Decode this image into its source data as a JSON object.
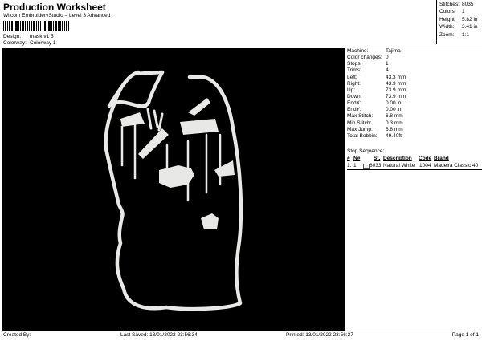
{
  "header": {
    "title": "Production Worksheet",
    "subtitle": "Wilcom EmbroideryStudio – Level 3 Advanced",
    "design_label": "Design:",
    "design_value": "mask v1 5",
    "colorway_label": "Colorway:",
    "colorway_value": "Colorway 1"
  },
  "stats": [
    {
      "label": "Stitches:",
      "value": "8035"
    },
    {
      "label": "Colors:",
      "value": "1"
    },
    {
      "label": "Height:",
      "value": "5.82 in"
    },
    {
      "label": "Width:",
      "value": "3.41 in"
    },
    {
      "label": "Zoom:",
      "value": "1:1"
    }
  ],
  "properties": [
    {
      "label": "Machine:",
      "value": "Tajima"
    },
    {
      "label": "Color changes:",
      "value": "0"
    },
    {
      "label": "Stops:",
      "value": "1"
    },
    {
      "label": "Trims:",
      "value": "4"
    },
    {
      "label": "Left:",
      "value": "43.3 mm"
    },
    {
      "label": "Right:",
      "value": "43.3 mm"
    },
    {
      "label": "Up:",
      "value": "73.9 mm"
    },
    {
      "label": "Down:",
      "value": "73.9 mm"
    },
    {
      "label": "EndX:",
      "value": "0.00 in"
    },
    {
      "label": "EndY:",
      "value": "0.00 in"
    },
    {
      "label": "Max Stitch:",
      "value": "6.8 mm"
    },
    {
      "label": "Min Stitch:",
      "value": "0.3 mm"
    },
    {
      "label": "Max Jump:",
      "value": "6.8 mm"
    },
    {
      "label": "Total Bobbin:",
      "value": "49.40ft"
    }
  ],
  "stop_sequence": {
    "label": "Stop Sequence:",
    "headers": {
      "hash": "#",
      "n": "N#",
      "st": "St.",
      "description": "Description",
      "code": "Code",
      "brand": "Brand"
    },
    "rows": [
      {
        "hash": "1.",
        "n": "1",
        "swatch_color": "#f2f2f2",
        "st": "8033",
        "description": "Natural White",
        "code": "1004",
        "brand": "Madeira Classic 40"
      }
    ]
  },
  "design_colors": {
    "background": "#000000",
    "thread": "#e8e8e6"
  },
  "footer": {
    "created_by": "Created By:",
    "last_saved": "Last Saved: 13/01/2022 23:56:34",
    "printed": "Printed: 13/01/2022 23:56:37",
    "page": "Page 1 of 1"
  }
}
